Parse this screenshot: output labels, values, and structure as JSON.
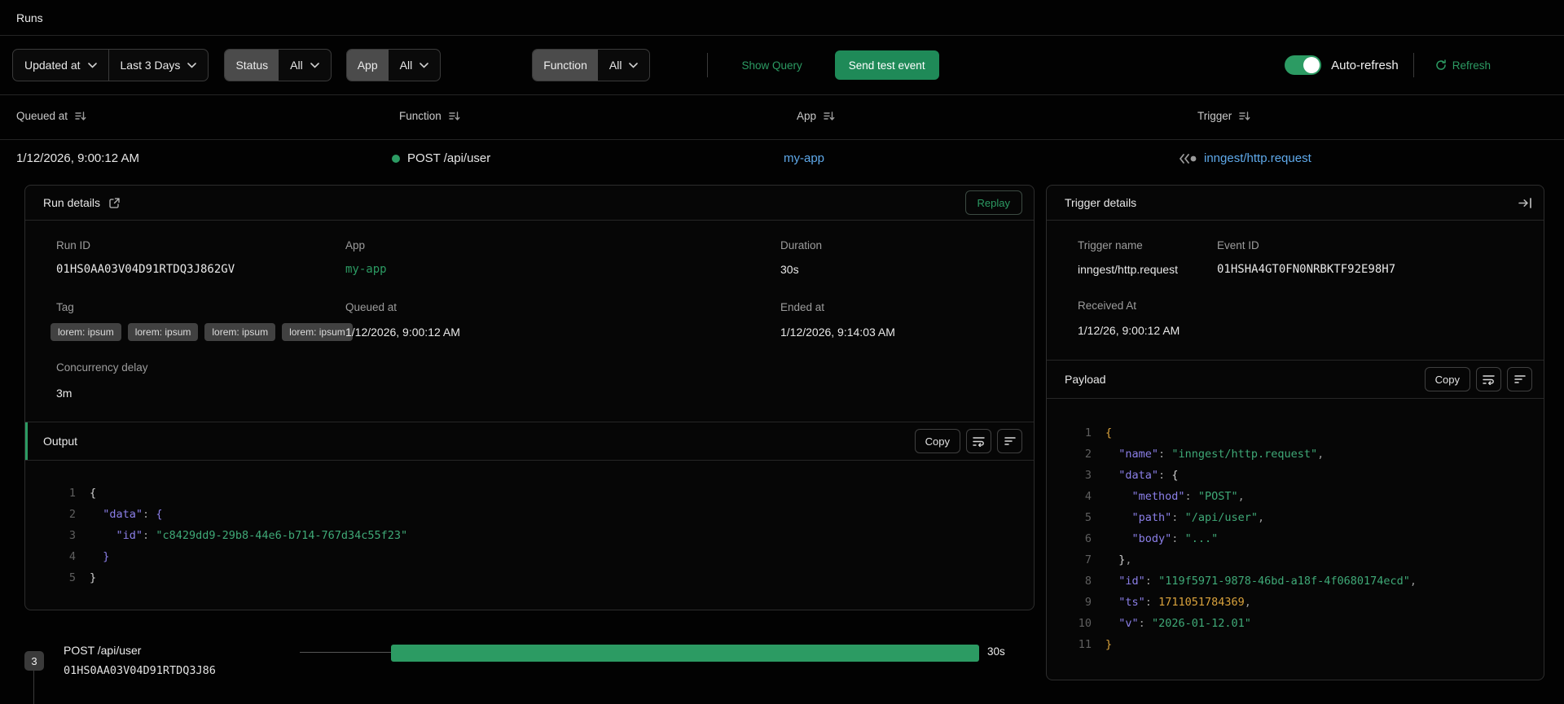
{
  "page": {
    "title": "Runs"
  },
  "filters": {
    "sort_field": {
      "label": "Updated at"
    },
    "time_range": {
      "label": "Last 3 Days"
    },
    "status": {
      "label": "Status",
      "value": "All"
    },
    "app": {
      "label": "App",
      "value": "All"
    },
    "function": {
      "label": "Function",
      "value": "All"
    },
    "show_query_label": "Show Query",
    "send_test_event_label": "Send test event",
    "auto_refresh_label": "Auto-refresh",
    "refresh_label": "Refresh"
  },
  "table": {
    "columns": {
      "queued_at": "Queued at",
      "function": "Function",
      "app": "App",
      "trigger": "Trigger"
    },
    "row": {
      "queued_at": "1/12/2026, 9:00:12 AM",
      "function": "POST /api/user",
      "app": "my-app",
      "trigger": "inngest/http.request"
    }
  },
  "run_details": {
    "title": "Run details",
    "replay_label": "Replay",
    "fields": {
      "run_id_label": "Run ID",
      "run_id": "01HS0AA03V04D91RTDQ3J862GV",
      "app_label": "App",
      "app": "my-app",
      "duration_label": "Duration",
      "duration": "30s",
      "tag_label": "Tag",
      "tags": [
        "lorem: ipsum",
        "lorem: ipsum",
        "lorem: ipsum",
        "lorem: ipsum"
      ],
      "queued_at_label": "Queued at",
      "queued_at": "1/12/2026, 9:00:12 AM",
      "ended_at_label": "Ended at",
      "ended_at": "1/12/2026, 9:14:03 AM",
      "concurrency_label": "Concurrency delay",
      "concurrency": "3m"
    },
    "output": {
      "title": "Output",
      "copy_label": "Copy",
      "code": [
        {
          "n": 1,
          "s": [
            [
              "{",
              "br"
            ]
          ]
        },
        {
          "n": 2,
          "s": [
            [
              "  ",
              "def"
            ],
            [
              "\"data\"",
              "key"
            ],
            [
              ":",
              "pun"
            ],
            [
              " ",
              "def"
            ],
            [
              "{",
              "vio"
            ]
          ]
        },
        {
          "n": 3,
          "s": [
            [
              "    ",
              "def"
            ],
            [
              "\"id\"",
              "key"
            ],
            [
              ":",
              "pun"
            ],
            [
              " ",
              "def"
            ],
            [
              "\"c8429dd9-29b8-44e6-b714-767d34c55f23\"",
              "str"
            ]
          ]
        },
        {
          "n": 4,
          "s": [
            [
              "  ",
              "def"
            ],
            [
              "}",
              "vio"
            ]
          ]
        },
        {
          "n": 5,
          "s": [
            [
              "}",
              "br"
            ]
          ]
        }
      ]
    }
  },
  "trigger_details": {
    "title": "Trigger details",
    "fields": {
      "trigger_name_label": "Trigger name",
      "trigger_name": "inngest/http.request",
      "event_id_label": "Event ID",
      "event_id": "01HSHA4GT0FN0NRBKTF92E98H7",
      "received_at_label": "Received At",
      "received_at": "1/12/26, 9:00:12 AM"
    },
    "payload": {
      "title": "Payload",
      "copy_label": "Copy",
      "code": [
        {
          "n": 1,
          "s": [
            [
              "{",
              "amb"
            ]
          ]
        },
        {
          "n": 2,
          "s": [
            [
              "  ",
              "def"
            ],
            [
              "\"name\"",
              "key"
            ],
            [
              ":",
              "pun"
            ],
            [
              " ",
              "def"
            ],
            [
              "\"inngest/http.request\"",
              "str"
            ],
            [
              ",",
              "pun"
            ]
          ]
        },
        {
          "n": 3,
          "s": [
            [
              "  ",
              "def"
            ],
            [
              "\"data\"",
              "key"
            ],
            [
              ":",
              "pun"
            ],
            [
              " ",
              "def"
            ],
            [
              "{",
              "br"
            ]
          ]
        },
        {
          "n": 4,
          "s": [
            [
              "    ",
              "def"
            ],
            [
              "\"method\"",
              "key"
            ],
            [
              ":",
              "pun"
            ],
            [
              " ",
              "def"
            ],
            [
              "\"POST\"",
              "str"
            ],
            [
              ",",
              "pun"
            ]
          ]
        },
        {
          "n": 5,
          "s": [
            [
              "    ",
              "def"
            ],
            [
              "\"path\"",
              "key"
            ],
            [
              ":",
              "pun"
            ],
            [
              " ",
              "def"
            ],
            [
              "\"/api/user\"",
              "str"
            ],
            [
              ",",
              "pun"
            ]
          ]
        },
        {
          "n": 6,
          "s": [
            [
              "    ",
              "def"
            ],
            [
              "\"body\"",
              "key"
            ],
            [
              ":",
              "pun"
            ],
            [
              " ",
              "def"
            ],
            [
              "\"...\"",
              "str"
            ]
          ]
        },
        {
          "n": 7,
          "s": [
            [
              "  ",
              "def"
            ],
            [
              "}",
              "br"
            ],
            [
              ",",
              "pun"
            ]
          ]
        },
        {
          "n": 8,
          "s": [
            [
              "  ",
              "def"
            ],
            [
              "\"id\"",
              "key"
            ],
            [
              ":",
              "pun"
            ],
            [
              " ",
              "def"
            ],
            [
              "\"119f5971-9878-46bd-a18f-4f0680174ecd\"",
              "str"
            ],
            [
              ",",
              "pun"
            ]
          ]
        },
        {
          "n": 9,
          "s": [
            [
              "  ",
              "def"
            ],
            [
              "\"ts\"",
              "key"
            ],
            [
              ":",
              "pun"
            ],
            [
              " ",
              "def"
            ],
            [
              "1711051784369",
              "num"
            ],
            [
              ",",
              "pun"
            ]
          ]
        },
        {
          "n": 10,
          "s": [
            [
              "  ",
              "def"
            ],
            [
              "\"v\"",
              "key"
            ],
            [
              ":",
              "pun"
            ],
            [
              " ",
              "def"
            ],
            [
              "\"2026-01-12.01\"",
              "str"
            ]
          ]
        },
        {
          "n": 11,
          "s": [
            [
              "}",
              "amb"
            ]
          ]
        }
      ]
    }
  },
  "timeline": {
    "step_count": "3",
    "function": "POST /api/user",
    "run_id": "01HS0AA03V04D91RTDQ3J86",
    "duration": "30s"
  },
  "colors": {
    "accent_green": "#2c9b63",
    "link_blue": "#5fa9ea",
    "json_key": "#8b7fe8",
    "json_string": "#3fa977",
    "json_number": "#d9a23c"
  }
}
